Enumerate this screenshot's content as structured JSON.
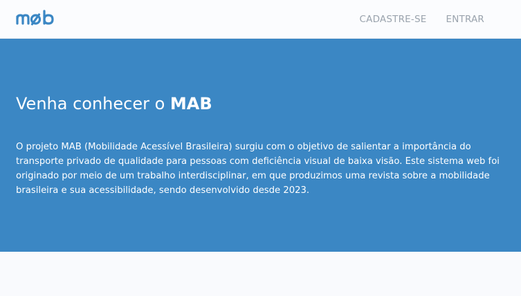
{
  "header": {
    "logo_text": "mob",
    "nav": [
      {
        "label": "CADASTRE-SE"
      },
      {
        "label": "ENTRAR"
      }
    ]
  },
  "hero": {
    "title_prefix": "Venha conhecer o ",
    "title_highlight": "MAB",
    "description": "O projeto MAB (Mobilidade Acessível Brasileira) surgiu com o objetivo de salientar a importância do transporte privado de qualidade para pessoas com deficiência visual de baixa visão. Este sistema web foi originado por meio de um trabalho interdisciplinar, em que produzimos uma revista sobre a mobilidade brasileira e sua acessibilidade, sendo desenvolvido desde 2023."
  },
  "colors": {
    "brand": "#3b87c4",
    "nav_text": "#9aa3ad",
    "background": "#f9fafd"
  }
}
